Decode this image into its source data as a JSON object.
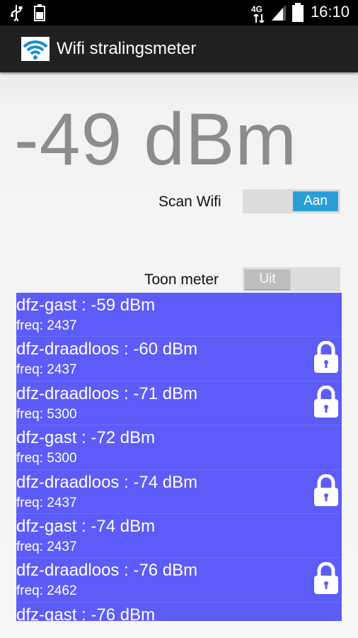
{
  "statusbar": {
    "time": "16:10",
    "network": "4G",
    "icons": [
      "usb-icon",
      "battery-full-icon",
      "network-4g-icon",
      "signal-icon",
      "battery-icon"
    ]
  },
  "actionbar": {
    "title": "Wifi stralingsmeter",
    "icon": "wifi-icon"
  },
  "reading": "-49 dBm",
  "scan": {
    "label": "Scan Wifi",
    "state": "Aan"
  },
  "meter": {
    "label": "Toon meter",
    "state": "Uit"
  },
  "networks": [
    {
      "ssid": "dfz-gast : -59 dBm",
      "freq": "freq: 2437",
      "locked": false
    },
    {
      "ssid": "dfz-draadloos : -60 dBm",
      "freq": "freq: 2437",
      "locked": true
    },
    {
      "ssid": "dfz-draadloos : -71 dBm",
      "freq": "freq: 5300",
      "locked": true
    },
    {
      "ssid": "dfz-gast : -72 dBm",
      "freq": "freq: 5300",
      "locked": false
    },
    {
      "ssid": "dfz-draadloos : -74 dBm",
      "freq": "freq: 2437",
      "locked": true
    },
    {
      "ssid": "dfz-gast : -74 dBm",
      "freq": "freq: 2437",
      "locked": false
    },
    {
      "ssid": "dfz-draadloos : -76 dBm",
      "freq": "freq: 2462",
      "locked": true
    },
    {
      "ssid": "dfz-gast : -76 dBm",
      "freq": "",
      "locked": false
    }
  ],
  "colors": {
    "list_bg": "#5d5cf8",
    "toggle_on": "#2a9fd6",
    "reading": "#8c8c8c"
  }
}
